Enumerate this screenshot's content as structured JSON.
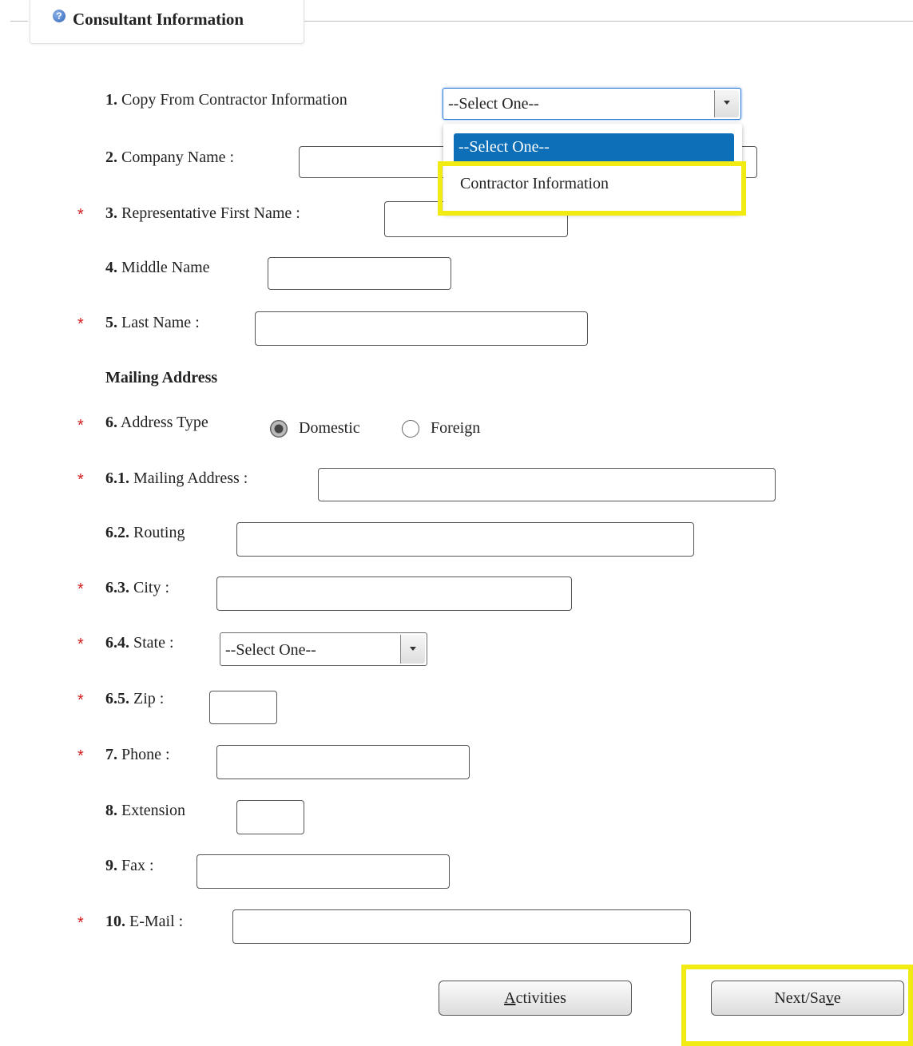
{
  "section": {
    "title": "Consultant Information"
  },
  "fields": {
    "copy_from": {
      "num": "1.",
      "label": "Copy From Contractor Information",
      "value": "--Select One--"
    },
    "company_name": {
      "num": "2.",
      "label": "Company Name :"
    },
    "first_name": {
      "num": "3.",
      "label": "Representative First Name :"
    },
    "middle_name": {
      "num": "4.",
      "label": "Middle Name"
    },
    "last_name": {
      "num": "5.",
      "label": "Last Name :"
    },
    "mailing_header": "Mailing Address",
    "address_type": {
      "num": "6.",
      "label": "Address Type",
      "options": [
        "Domestic",
        "Foreign"
      ],
      "selected": "Domestic"
    },
    "mailing_address": {
      "num": "6.1.",
      "label": "Mailing Address :"
    },
    "routing": {
      "num": "6.2.",
      "label": "Routing"
    },
    "city": {
      "num": "6.3.",
      "label": "City :"
    },
    "state": {
      "num": "6.4.",
      "label": "State :",
      "value": "--Select One--"
    },
    "zip": {
      "num": "6.5.",
      "label": "Zip :"
    },
    "phone": {
      "num": "7.",
      "label": "Phone :"
    },
    "extension": {
      "num": "8.",
      "label": "Extension"
    },
    "fax": {
      "num": "9.",
      "label": "Fax :"
    },
    "email": {
      "num": "10.",
      "label": "E-Mail :"
    }
  },
  "required_mark": "*",
  "dropdown": {
    "options": [
      "--Select One--",
      "Contractor Information"
    ],
    "highlighted_index": 0
  },
  "buttons": {
    "activities": {
      "accesskey": "A",
      "rest": "ctivities"
    },
    "next_save": {
      "pre": "Next/Sa",
      "accesskey": "v",
      "post": "e"
    }
  },
  "colors": {
    "required": "#d21c1c",
    "highlight": "#f2ea13",
    "selected_option": "#0d6fb8"
  }
}
